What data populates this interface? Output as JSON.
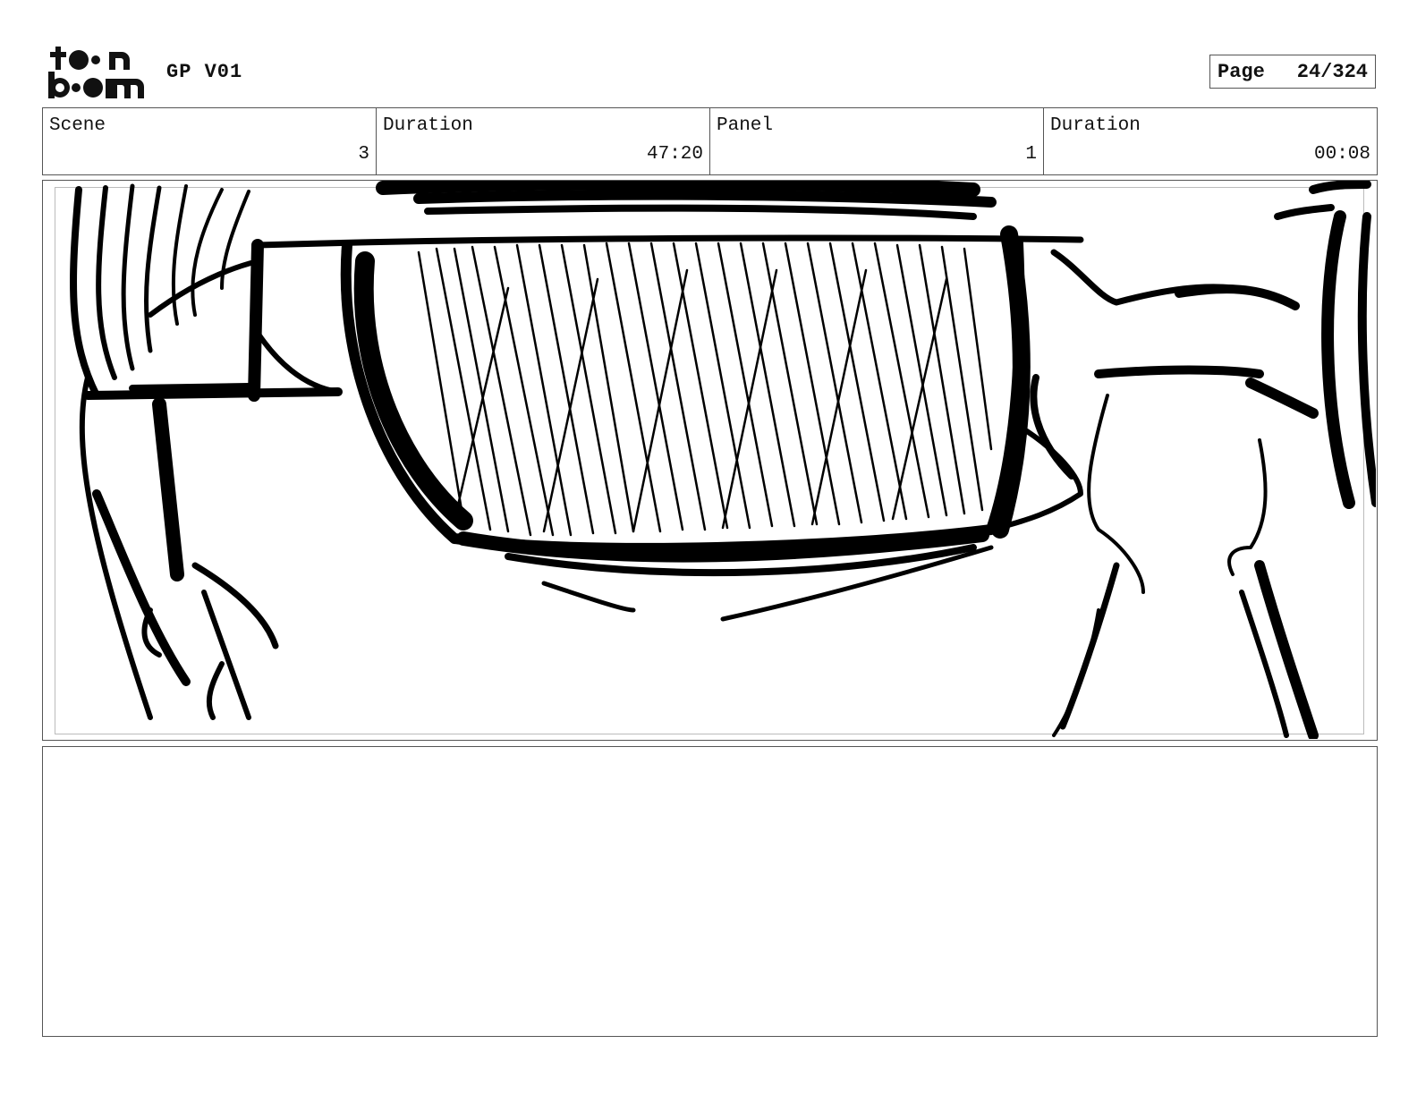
{
  "header": {
    "logo": {
      "line1": "toon",
      "line2": "boom",
      "icon": "toon-boom-logo"
    },
    "project_title": "GP V01",
    "page": {
      "label": "Page",
      "value": "24/324"
    }
  },
  "info": {
    "scene": {
      "label": "Scene",
      "value": "3"
    },
    "scene_duration": {
      "label": "Duration",
      "value": "47:20"
    },
    "panel": {
      "label": "Panel",
      "value": "1"
    },
    "panel_duration": {
      "label": "Duration",
      "value": "00:08"
    }
  },
  "panel": {
    "image": "storyboard-sketch-close-up-eyeglasses"
  },
  "notes": {
    "text": ""
  }
}
